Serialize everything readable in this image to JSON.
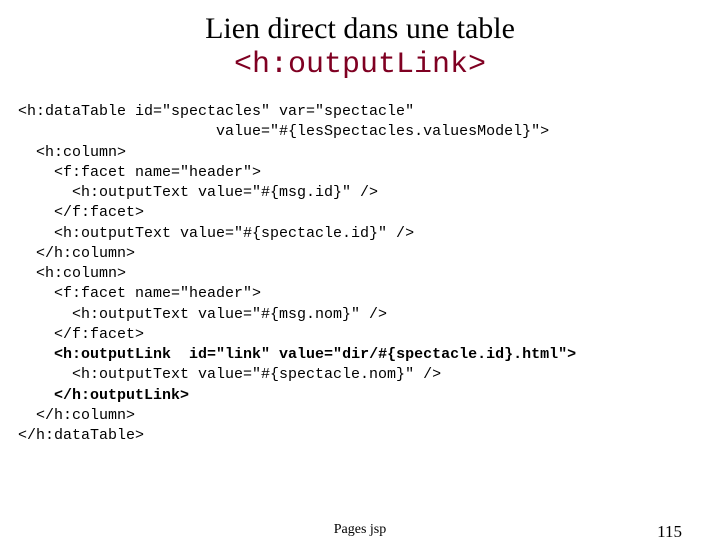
{
  "header": {
    "title": "Lien direct dans une table",
    "subtitle": "<h:outputLink>"
  },
  "code": {
    "l0a": "<h:dataTable id=\"spectacles\" var=\"spectacle\"",
    "l0b": "                      value=\"#{lesSpectacles.valuesModel}\">",
    "l1": "  <h:column>",
    "l2": "    <f:facet name=\"header\">",
    "l3": "      <h:outputText value=\"#{msg.id}\" />",
    "l4": "    </f:facet>",
    "l5": "    <h:outputText value=\"#{spectacle.id}\" />",
    "l6": "  </h:column>",
    "l7": "  <h:column>",
    "l8": "    <f:facet name=\"header\">",
    "l9": "      <h:outputText value=\"#{msg.nom}\" />",
    "l10": "    </f:facet>",
    "l11a": "    ",
    "l11b": "<h:outputLink  id=\"link\" value=\"dir/#{spectacle.id}.html\">",
    "l12": "      <h:outputText value=\"#{spectacle.nom}\" />",
    "l13a": "    ",
    "l13b": "</h:outputLink>",
    "l14": "  </h:column>",
    "l15": "</h:dataTable>"
  },
  "footer": {
    "center": "Pages jsp",
    "pageNumber": "115"
  }
}
